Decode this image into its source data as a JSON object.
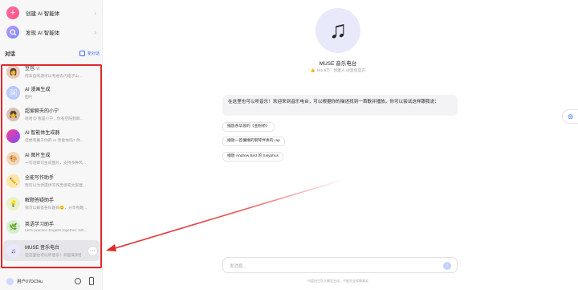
{
  "sidebar": {
    "create_label": "创建 AI 智能体",
    "discover_label": "发现 AI 智能体",
    "section_title": "对话",
    "new_chat_label": "新对话",
    "chats": [
      {
        "name": "豆包 ☆",
        "subtitle": "周末自驾游可以考虑去闪电子山..."
      },
      {
        "name": "AI 漫画生成",
        "subtitle": "图片"
      },
      {
        "name": "超爱聊天的小宁",
        "subtitle": "哈哈😉 我是小宁，你有空陪我聊..."
      },
      {
        "name": "AI 智能体生成器",
        "subtitle": "您想有属于你的 AI 智能体吗? 你..."
      },
      {
        "name": "AI 图片生成",
        "subtitle": "一句话即可生成图片，支持多种风..."
      },
      {
        "name": "全能写作助手",
        "subtitle": "我可以为你提供写作灵感或文案建..."
      },
      {
        "name": "解题答疑助手",
        "subtitle": "我可以解答各科题目🙂，分享有趣..."
      },
      {
        "name": "英语学习助手",
        "subtitle": "Let's practice English together. Wh..."
      },
      {
        "name": "MUSE 音乐电台",
        "subtitle": "在这里也可以听音乐！欢迎来到音..."
      }
    ],
    "user_name": "用户07DCNu"
  },
  "main": {
    "bot_name": "MUSE 音乐电台",
    "bot_meta": "👍 162.5万 · 创建人 @豆包官方",
    "greeting": "在这里也可以听音乐！欢迎来到音乐电台，可以根据你的描述找到一首歌并播放。你可以尝试这样跟我说：",
    "suggestions": [
      "播放余华蓉的《金粉桥》",
      "播放一首慵懒的钢琴伴奏的 rap",
      "播放 Andrew Bird 的 Sisyphus"
    ],
    "input_placeholder": "发消息...",
    "disclaimer": "内容由豆包大模型生成，不能完全保障真实"
  },
  "colors": {
    "accent": "#3b6cff",
    "annotation_red": "#e0292b"
  }
}
